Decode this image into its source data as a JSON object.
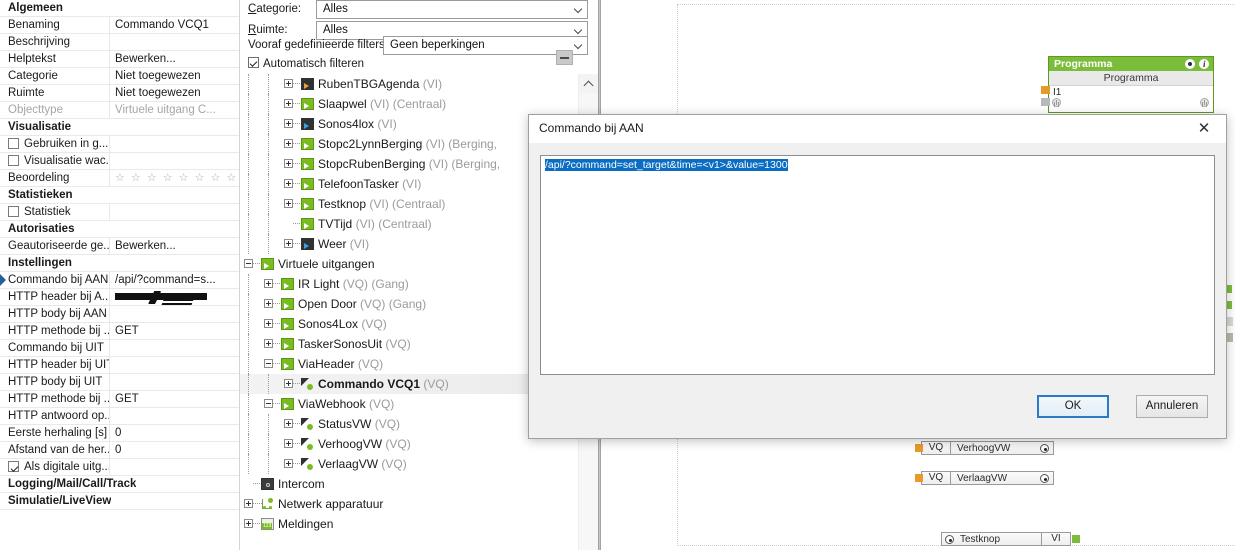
{
  "properties_panel": {
    "groups": [
      {
        "header": "Algemeen",
        "rows": [
          {
            "label": "Benaming",
            "value": "Commando VCQ1"
          },
          {
            "label": "Beschrijving",
            "value": ""
          },
          {
            "label": "Helptekst",
            "value": "Bewerken..."
          },
          {
            "label": "Categorie",
            "value": "Niet toegewezen"
          },
          {
            "label": "Ruimte",
            "value": "Niet toegewezen"
          },
          {
            "label": "Objecttype",
            "value": "Virtuele uitgang C..."
          }
        ]
      },
      {
        "header": "Visualisatie",
        "rows": [
          {
            "label": "Gebruiken in g...",
            "value": ""
          },
          {
            "label": "Visualisatie wac...",
            "value": ""
          },
          {
            "label": "Beoordeling",
            "value": "☆ ☆ ☆ ☆ ☆ ☆ ☆ ☆"
          }
        ]
      },
      {
        "header": "Statistieken",
        "rows": [
          {
            "label": "Statistiek",
            "value": ""
          }
        ]
      },
      {
        "header": "Autorisaties",
        "rows": [
          {
            "label": "Geautoriseerde ge...",
            "value": "Bewerken..."
          }
        ]
      },
      {
        "header": "Instellingen",
        "rows": [
          {
            "label": "Commando bij AAN",
            "value": "/api/?command=s..."
          },
          {
            "label": "HTTP header bij A...",
            "value": ""
          },
          {
            "label": "HTTP body bij AAN",
            "value": ""
          },
          {
            "label": "HTTP methode bij ...",
            "value": "GET"
          },
          {
            "label": "Commando bij UIT",
            "value": ""
          },
          {
            "label": "HTTP header bij UIT",
            "value": ""
          },
          {
            "label": "HTTP body bij UIT",
            "value": ""
          },
          {
            "label": "HTTP methode bij ...",
            "value": "GET"
          },
          {
            "label": "HTTP antwoord op...",
            "value": ""
          },
          {
            "label": "Eerste herhaling [s]",
            "value": "0"
          },
          {
            "label": "Afstand van de her...",
            "value": "0"
          },
          {
            "label": "Als digitale uitg...",
            "value": ""
          }
        ]
      },
      {
        "header": "Logging/Mail/Call/Track",
        "rows": []
      },
      {
        "header": "Simulatie/LiveView",
        "rows": []
      }
    ]
  },
  "filters": {
    "categorie_label": "Categorie:",
    "categorie_value": "Alles",
    "ruimte_label": "Ruimte:",
    "ruimte_value": "Alles",
    "predefined_label": "Vooraf gedefinieerde filters",
    "predefined_value": "Geen beperkingen",
    "autofilter_label": "Automatisch filteren",
    "autofilter_checked": true
  },
  "tree": {
    "nodes": [
      {
        "depth": 3,
        "label": "RubenTBGAgenda",
        "meta": "(VI)",
        "icon": "virtual-input-icon",
        "expandable": true
      },
      {
        "depth": 3,
        "label": "Slaapwel",
        "meta": "(VI) (Centraal)",
        "icon": "virtual-output-icon",
        "expandable": true
      },
      {
        "depth": 3,
        "label": "Sonos4lox",
        "meta": "(VI)",
        "icon": "virtual-input-icon",
        "expandable": true
      },
      {
        "depth": 3,
        "label": "Stopc2LynnBerging",
        "meta": "(VI) (Berging,",
        "icon": "virtual-output-icon",
        "expandable": true
      },
      {
        "depth": 3,
        "label": "StopcRubenBerging",
        "meta": "(VI) (Berging,",
        "icon": "virtual-output-icon",
        "expandable": true
      },
      {
        "depth": 3,
        "label": "TelefoonTasker",
        "meta": "(VI)",
        "icon": "virtual-output-icon",
        "expandable": true
      },
      {
        "depth": 3,
        "label": "Testknop",
        "meta": "(VI) (Centraal)",
        "icon": "virtual-output-icon",
        "expandable": true
      },
      {
        "depth": 3,
        "label": "TVTijd",
        "meta": "(VI) (Centraal)",
        "icon": "virtual-output-icon",
        "expandable": false
      },
      {
        "depth": 3,
        "label": "Weer",
        "meta": "(VI)",
        "icon": "virtual-input-icon",
        "expandable": true
      },
      {
        "depth": 1,
        "label": "Virtuele uitgangen",
        "meta": "",
        "icon": "virtual-output-icon",
        "expandable": true,
        "expanded": true
      },
      {
        "depth": 2,
        "label": "IR Light",
        "meta": "(VQ) (Gang)",
        "icon": "virtual-output-icon",
        "expandable": true
      },
      {
        "depth": 2,
        "label": "Open Door",
        "meta": "(VQ) (Gang)",
        "icon": "virtual-output-icon",
        "expandable": true
      },
      {
        "depth": 2,
        "label": "Sonos4Lox",
        "meta": "(VQ)",
        "icon": "virtual-output-icon",
        "expandable": true
      },
      {
        "depth": 2,
        "label": "TaskerSonosUit",
        "meta": "(VQ)",
        "icon": "virtual-output-icon",
        "expandable": true
      },
      {
        "depth": 2,
        "label": "ViaHeader",
        "meta": "(VQ)",
        "icon": "virtual-output-icon",
        "expandable": true,
        "expanded": true
      },
      {
        "depth": 3,
        "label": "Commando VCQ1",
        "meta": "(VQ)",
        "icon": "virtual-command-icon",
        "expandable": true,
        "selected": true
      },
      {
        "depth": 2,
        "label": "ViaWebhook",
        "meta": "(VQ)",
        "icon": "virtual-output-icon",
        "expandable": true,
        "expanded": true
      },
      {
        "depth": 3,
        "label": "StatusVW",
        "meta": "(VQ)",
        "icon": "virtual-command-icon",
        "expandable": true
      },
      {
        "depth": 3,
        "label": "VerhoogVW",
        "meta": "(VQ)",
        "icon": "virtual-command-icon",
        "expandable": true
      },
      {
        "depth": 3,
        "label": "VerlaagVW",
        "meta": "(VQ)",
        "icon": "virtual-command-icon",
        "expandable": true
      },
      {
        "depth": 1,
        "label": "Intercom",
        "meta": "",
        "icon": "intercom-icon",
        "expandable": false
      },
      {
        "depth": 1,
        "label": "Netwerk apparatuur",
        "meta": "",
        "icon": "network-icon",
        "expandable": true
      },
      {
        "depth": 1,
        "label": "Meldingen",
        "meta": "",
        "icon": "messages-icon",
        "expandable": true
      }
    ]
  },
  "canvas": {
    "program_block": {
      "header": "Programma",
      "subheader": "Programma",
      "pin_label": "I1"
    },
    "small_blocks": [
      {
        "tag_left": "VQ",
        "name": "VerhoogVW"
      },
      {
        "tag_left": "VQ",
        "name": "VerlaagVW"
      }
    ],
    "testknop_block": {
      "name": "Testknop",
      "tag_right": "VI"
    }
  },
  "dialog": {
    "title": "Commando bij AAN",
    "close_icon": "✕",
    "text_value": "/api/?command=set_target&time=<v1>&value=1300",
    "ok_label": "OK",
    "cancel_label": "Annuleren",
    "selection_color": "#0a6dc4"
  }
}
